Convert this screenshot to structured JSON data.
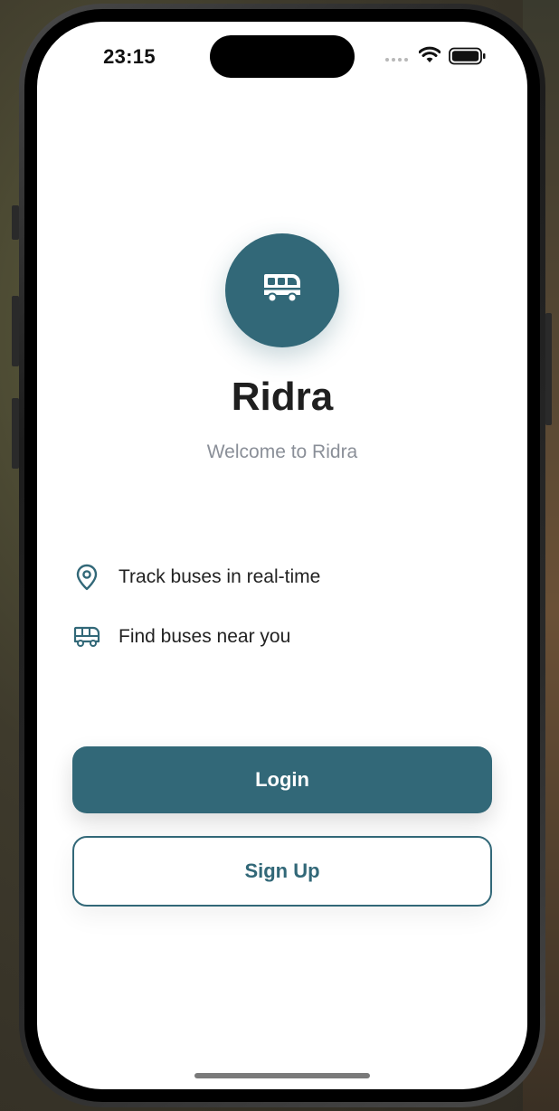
{
  "status_bar": {
    "time": "23:15",
    "icons": [
      "cellular-dots-icon",
      "wifi-icon",
      "battery-icon"
    ]
  },
  "app": {
    "logo_icon": "bus-icon",
    "title": "Ridra",
    "subtitle": "Welcome to Ridra"
  },
  "features": [
    {
      "icon": "location-pin-icon",
      "label": "Track buses in real-time"
    },
    {
      "icon": "bus-icon",
      "label": "Find buses near you"
    }
  ],
  "actions": {
    "login_label": "Login",
    "signup_label": "Sign Up"
  },
  "colors": {
    "primary": "#326878",
    "title_text": "#1f1f1f",
    "subtitle_text": "#8a8f98",
    "background": "#ffffff"
  }
}
